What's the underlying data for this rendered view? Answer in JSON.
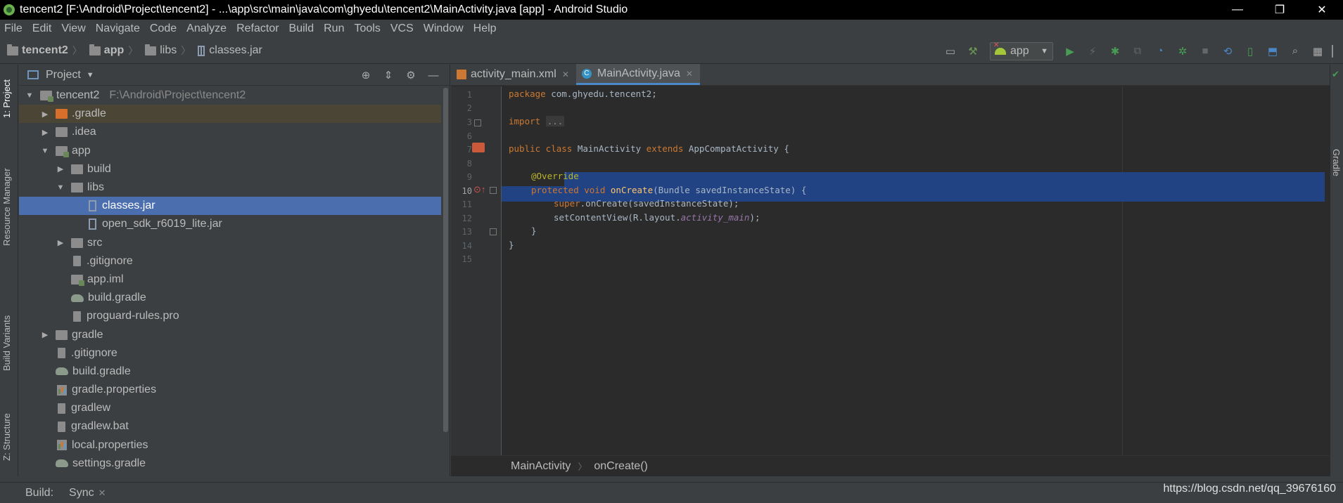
{
  "window": {
    "title": "tencent2 [F:\\Android\\Project\\tencent2] - ...\\app\\src\\main\\java\\com\\ghyedu\\tencent2\\MainActivity.java [app] - Android Studio",
    "minimize": "—",
    "maximize": "❐",
    "close": "✕"
  },
  "menu": [
    "File",
    "Edit",
    "View",
    "Navigate",
    "Code",
    "Analyze",
    "Refactor",
    "Build",
    "Run",
    "Tools",
    "VCS",
    "Window",
    "Help"
  ],
  "breadcrumb": {
    "project": "tencent2",
    "module": "app",
    "folder": "libs",
    "file": "classes.jar"
  },
  "toolbar": {
    "run_config": "app",
    "icons": [
      "sdk-manager-icon",
      "build-hammer-icon",
      "run-icon",
      "apply-changes-icon",
      "debug-icon",
      "attach-debugger-icon",
      "profile-icon",
      "run-coverage-icon",
      "stop-icon",
      "sync-icon",
      "avd-manager-icon",
      "sdk-icon",
      "search-icon",
      "project-structure-icon"
    ]
  },
  "left_tabs": {
    "project": "1: Project",
    "resource_manager": "Resource Manager",
    "build_variants": "Build Variants",
    "structure": "Z: Structure"
  },
  "right_tabs": {
    "gradle": "Gradle"
  },
  "project_panel": {
    "title": "Project",
    "tree": [
      {
        "label": "tencent2",
        "path": "F:\\Android\\Project\\tencent2",
        "depth": 0,
        "arrow": "▼",
        "icon": "module"
      },
      {
        "label": ".gradle",
        "depth": 1,
        "arrow": "▶",
        "icon": "folder-orange",
        "state": "hl"
      },
      {
        "label": ".idea",
        "depth": 1,
        "arrow": "▶",
        "icon": "folder"
      },
      {
        "label": "app",
        "depth": 1,
        "arrow": "▼",
        "icon": "module"
      },
      {
        "label": "build",
        "depth": 2,
        "arrow": "▶",
        "icon": "folder"
      },
      {
        "label": "libs",
        "depth": 2,
        "arrow": "▼",
        "icon": "folder"
      },
      {
        "label": "classes.jar",
        "depth": 3,
        "arrow": "",
        "icon": "jar",
        "state": "sel"
      },
      {
        "label": "open_sdk_r6019_lite.jar",
        "depth": 3,
        "arrow": "",
        "icon": "jar"
      },
      {
        "label": "src",
        "depth": 2,
        "arrow": "▶",
        "icon": "folder"
      },
      {
        "label": ".gitignore",
        "depth": 2,
        "arrow": "",
        "icon": "file"
      },
      {
        "label": "app.iml",
        "depth": 2,
        "arrow": "",
        "icon": "module"
      },
      {
        "label": "build.gradle",
        "depth": 2,
        "arrow": "",
        "icon": "gradle"
      },
      {
        "label": "proguard-rules.pro",
        "depth": 2,
        "arrow": "",
        "icon": "file"
      },
      {
        "label": "gradle",
        "depth": 1,
        "arrow": "▶",
        "icon": "folder"
      },
      {
        "label": ".gitignore",
        "depth": 1,
        "arrow": "",
        "icon": "file"
      },
      {
        "label": "build.gradle",
        "depth": 1,
        "arrow": "",
        "icon": "gradle"
      },
      {
        "label": "gradle.properties",
        "depth": 1,
        "arrow": "",
        "icon": "props"
      },
      {
        "label": "gradlew",
        "depth": 1,
        "arrow": "",
        "icon": "file"
      },
      {
        "label": "gradlew.bat",
        "depth": 1,
        "arrow": "",
        "icon": "file"
      },
      {
        "label": "local.properties",
        "depth": 1,
        "arrow": "",
        "icon": "props"
      },
      {
        "label": "settings.gradle",
        "depth": 1,
        "arrow": "",
        "icon": "gradle"
      }
    ]
  },
  "editor": {
    "tabs": [
      {
        "label": "activity_main.xml",
        "active": false
      },
      {
        "label": "MainActivity.java",
        "active": true
      }
    ],
    "line_numbers": [
      "1",
      "2",
      "3",
      "6",
      "7",
      "8",
      "9",
      "10",
      "11",
      "12",
      "13",
      "14",
      "15"
    ],
    "current_line": "10",
    "code": {
      "l1": [
        "package",
        " com.ghyedu.tencent2;"
      ],
      "l3": [
        "import",
        " ",
        "..."
      ],
      "l7": [
        "public class",
        " MainActivity ",
        "extends",
        " AppCompatActivity {"
      ],
      "l9": "@Override",
      "l10": [
        "protected void",
        " ",
        "onCreate",
        "(Bundle savedInstanceState) {"
      ],
      "l11": [
        "super",
        ".onCreate(savedInstanceState);"
      ],
      "l12": [
        "setContentView(R.layout.",
        "activity_main",
        ");"
      ],
      "l13": "}",
      "l14": "}"
    },
    "footer": {
      "class": "MainActivity",
      "method": "onCreate()"
    }
  },
  "bottom": {
    "build": "Build:",
    "sync": "Sync",
    "close": "✕"
  },
  "watermark": "https://blog.csdn.net/qq_39676160",
  "colors": {
    "background": "#2b2b2b",
    "panel": "#3c3f41",
    "selection": "#4b6eaf",
    "keyword": "#cc7832",
    "annotation": "#bbb529",
    "method": "#ffc66d"
  }
}
